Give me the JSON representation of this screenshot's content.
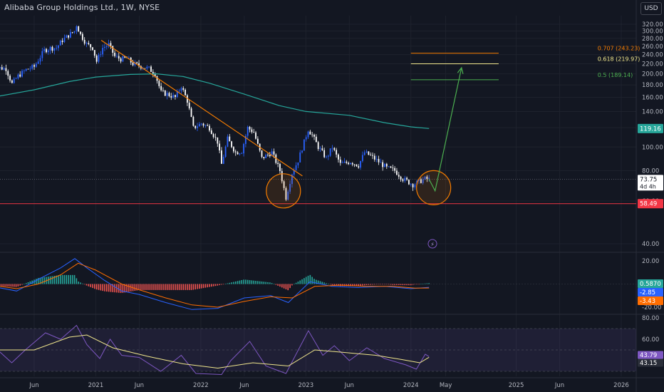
{
  "header": {
    "title": "Alibaba Group Holdings Ltd., 1W, NYSE",
    "currency_button": "USD"
  },
  "colors": {
    "background": "#131722",
    "grid": "#1e222d",
    "axis_text": "#b2b5be",
    "candle_up": "#2962ff",
    "candle_down": "#ffffff",
    "ma_line": "#26a69a",
    "trendline": "#f57c00",
    "fib_0707": "#f57c00",
    "fib_0618": "#f0e68c",
    "fib_05": "#4caf50",
    "support_line": "#f23645",
    "projection_arrow": "#4caf50",
    "circle_fill": "rgba(245,124,0,0.12)",
    "circle_stroke": "#f57c00",
    "macd_line": "#2962ff",
    "signal_line": "#ff6d00",
    "hist_pos": "#26a69a",
    "hist_neg": "#ef5350",
    "rsi_line": "#7e57c2",
    "rsi_ma": "#f0e68c",
    "rsi_band": "rgba(126,87,194,0.12)"
  },
  "chart_data": [
    {
      "type": "line",
      "panel": "price",
      "y_scale": "log",
      "ylim": [
        40,
        330
      ],
      "y_ticks": [
        "320.00",
        "300.00",
        "280.00",
        "260.00",
        "240.00",
        "220.00",
        "200.00",
        "180.00",
        "160.00",
        "140.00",
        "120.00",
        "100.00",
        "80.00",
        "60.00",
        "40.00"
      ],
      "x_ticks": [
        "Jun",
        "2021",
        "Jun",
        "2022",
        "Jun",
        "2023",
        "Jun",
        "2024",
        "May",
        "2025",
        "Jun",
        "2026"
      ],
      "x_tick_dates": [
        "2020-06-01",
        "2021-01-01",
        "2021-06-01",
        "2022-01-01",
        "2022-06-01",
        "2023-01-01",
        "2023-06-01",
        "2024-01-01",
        "2024-05-01",
        "2025-01-01",
        "2025-06-01",
        "2026-01-01"
      ],
      "x_range": [
        "2020-01-01",
        "2026-02-15"
      ],
      "series": [
        {
          "role": "price",
          "points": [
            [
              "2020-01-06",
              225
            ],
            [
              "2020-01-27",
              212
            ],
            [
              "2020-02-24",
              210
            ],
            [
              "2020-03-16",
              182
            ],
            [
              "2020-04-06",
              196
            ],
            [
              "2020-05-04",
              208
            ],
            [
              "2020-06-01",
              214
            ],
            [
              "2020-07-06",
              250
            ],
            [
              "2020-07-27",
              255
            ],
            [
              "2020-08-17",
              256
            ],
            [
              "2020-09-07",
              275
            ],
            [
              "2020-09-28",
              288
            ],
            [
              "2020-10-19",
              300
            ],
            [
              "2020-10-26",
              318
            ],
            [
              "2020-11-09",
              290
            ],
            [
              "2020-11-30",
              265
            ],
            [
              "2020-12-21",
              256
            ],
            [
              "2021-01-04",
              225
            ],
            [
              "2021-01-25",
              256
            ],
            [
              "2021-02-15",
              264
            ],
            [
              "2021-03-08",
              236
            ],
            [
              "2021-03-29",
              230
            ],
            [
              "2021-04-19",
              232
            ],
            [
              "2021-05-10",
              220
            ],
            [
              "2021-06-07",
              215
            ],
            [
              "2021-07-05",
              210
            ],
            [
              "2021-07-26",
              200
            ],
            [
              "2021-08-16",
              168
            ],
            [
              "2021-09-06",
              165
            ],
            [
              "2021-10-04",
              160
            ],
            [
              "2021-10-25",
              178
            ],
            [
              "2021-11-15",
              155
            ],
            [
              "2021-12-06",
              120
            ],
            [
              "2022-01-03",
              125
            ],
            [
              "2022-01-31",
              120
            ],
            [
              "2022-02-28",
              105
            ],
            [
              "2022-03-14",
              85
            ],
            [
              "2022-04-04",
              108
            ],
            [
              "2022-05-02",
              95
            ],
            [
              "2022-05-23",
              96
            ],
            [
              "2022-06-13",
              120
            ],
            [
              "2022-07-04",
              115
            ],
            [
              "2022-08-01",
              90
            ],
            [
              "2022-09-05",
              95
            ],
            [
              "2022-10-03",
              80
            ],
            [
              "2022-10-24",
              62
            ],
            [
              "2022-11-14",
              78
            ],
            [
              "2022-12-05",
              88
            ],
            [
              "2023-01-09",
              118
            ],
            [
              "2023-01-23",
              112
            ],
            [
              "2023-02-13",
              100
            ],
            [
              "2023-03-13",
              90
            ],
            [
              "2023-04-03",
              100
            ],
            [
              "2023-05-01",
              85
            ],
            [
              "2023-06-05",
              87
            ],
            [
              "2023-07-03",
              84
            ],
            [
              "2023-07-24",
              95
            ],
            [
              "2023-08-14",
              92
            ],
            [
              "2023-09-11",
              87
            ],
            [
              "2023-10-09",
              82
            ],
            [
              "2023-11-06",
              80
            ],
            [
              "2023-12-04",
              74
            ],
            [
              "2024-01-08",
              70
            ],
            [
              "2024-01-29",
              72
            ],
            [
              "2024-02-19",
              74
            ],
            [
              "2024-03-04",
              73.75
            ]
          ]
        },
        {
          "role": "moving-average",
          "points": [
            [
              "2020-01-06",
              160
            ],
            [
              "2020-06-01",
              172
            ],
            [
              "2020-10-01",
              186
            ],
            [
              "2021-01-01",
              194
            ],
            [
              "2021-05-01",
              199
            ],
            [
              "2021-08-01",
              200
            ],
            [
              "2021-11-01",
              195
            ],
            [
              "2022-02-01",
              183
            ],
            [
              "2022-06-01",
              165
            ],
            [
              "2022-10-01",
              148
            ],
            [
              "2023-01-01",
              140
            ],
            [
              "2023-06-01",
              135
            ],
            [
              "2023-10-01",
              126
            ],
            [
              "2024-01-01",
              121
            ],
            [
              "2024-03-04",
              119.16
            ]
          ]
        },
        {
          "role": "trendline",
          "points": [
            [
              "2021-01-20",
              275
            ],
            [
              "2022-12-20",
              76
            ]
          ]
        },
        {
          "role": "projection",
          "points": [
            [
              "2024-03-04",
              73.75
            ],
            [
              "2024-03-25",
              66
            ],
            [
              "2024-06-25",
              212
            ]
          ]
        }
      ],
      "levels": [
        {
          "label": "0.707 (243.23)",
          "value": 243.23,
          "start": "2024-01-01",
          "end": "2024-11-01",
          "color_key": "fib_0707"
        },
        {
          "label": "0.618 (219.97)",
          "value": 219.97,
          "start": "2024-01-01",
          "end": "2024-11-01",
          "color_key": "fib_0618"
        },
        {
          "label": "0.5 (189.14)",
          "value": 189.14,
          "start": "2024-01-01",
          "end": "2024-11-01",
          "color_key": "fib_05"
        }
      ],
      "support": {
        "value": 58.49,
        "label": "58.49"
      },
      "price_now": {
        "value": 73.75,
        "label": "73.75",
        "countdown": "4d 4h"
      },
      "ma_now": {
        "value": 119.16,
        "label": "119.16"
      },
      "highlights": [
        {
          "date": "2022-10-15",
          "value": 66
        },
        {
          "date": "2024-03-20",
          "value": 68
        }
      ]
    },
    {
      "type": "bar",
      "panel": "macd",
      "ylim": [
        -25,
        28
      ],
      "y_ticks": [
        "20.00",
        "-20.00"
      ],
      "last_values": [
        {
          "label": "0.5870",
          "value": 0.587,
          "color_key": "hist_pos"
        },
        {
          "label": "-2.85",
          "value": -2.85,
          "color_key": "macd_line"
        },
        {
          "label": "-3.43",
          "value": -3.43,
          "color_key": "signal_line"
        }
      ],
      "series": [
        {
          "name": "",
          "role": "macd",
          "points": [
            [
              "2020-01-06",
              -2
            ],
            [
              "2020-04-01",
              -6
            ],
            [
              "2020-06-15",
              4
            ],
            [
              "2020-09-01",
              14
            ],
            [
              "2020-10-20",
              22
            ],
            [
              "2020-12-01",
              14
            ],
            [
              "2021-02-01",
              3
            ],
            [
              "2021-04-01",
              -6
            ],
            [
              "2021-06-01",
              -9
            ],
            [
              "2021-09-01",
              -16
            ],
            [
              "2021-12-01",
              -22
            ],
            [
              "2022-03-01",
              -21
            ],
            [
              "2022-06-01",
              -12
            ],
            [
              "2022-09-01",
              -10
            ],
            [
              "2022-11-01",
              -16
            ],
            [
              "2023-01-15",
              2
            ],
            [
              "2023-04-01",
              -2
            ],
            [
              "2023-07-01",
              -3
            ],
            [
              "2023-10-01",
              -2
            ],
            [
              "2024-01-01",
              -4
            ],
            [
              "2024-03-04",
              -2.85
            ]
          ]
        },
        {
          "name": "",
          "role": "signal",
          "points": [
            [
              "2020-01-06",
              -1
            ],
            [
              "2020-04-01",
              -4
            ],
            [
              "2020-06-15",
              0
            ],
            [
              "2020-09-01",
              8
            ],
            [
              "2020-11-01",
              18
            ],
            [
              "2021-01-01",
              12
            ],
            [
              "2021-04-01",
              0
            ],
            [
              "2021-06-01",
              -5
            ],
            [
              "2021-09-01",
              -12
            ],
            [
              "2021-12-01",
              -18
            ],
            [
              "2022-03-01",
              -20
            ],
            [
              "2022-06-01",
              -15
            ],
            [
              "2022-09-01",
              -11
            ],
            [
              "2022-11-15",
              -12
            ],
            [
              "2023-02-01",
              -2
            ],
            [
              "2023-05-01",
              -1
            ],
            [
              "2023-08-01",
              -2
            ],
            [
              "2023-11-01",
              -2
            ],
            [
              "2024-01-15",
              -3.5
            ],
            [
              "2024-03-04",
              -3.43
            ]
          ]
        }
      ]
    },
    {
      "type": "line",
      "panel": "rsi",
      "ylim": [
        20,
        82
      ],
      "y_ticks": [
        "80.00",
        "60.00"
      ],
      "bands": [
        30,
        50,
        70
      ],
      "last_values": [
        {
          "label": "43.79",
          "value": 43.79,
          "color_key": "rsi_line"
        },
        {
          "label": "43.15",
          "value": 43.15,
          "color_key": "rsi_ma"
        }
      ],
      "series": [
        {
          "name": "",
          "role": "rsi",
          "points": [
            [
              "2020-01-06",
              55
            ],
            [
              "2020-03-15",
              38
            ],
            [
              "2020-05-01",
              50
            ],
            [
              "2020-07-10",
              66
            ],
            [
              "2020-09-01",
              60
            ],
            [
              "2020-10-26",
              73
            ],
            [
              "2020-12-01",
              55
            ],
            [
              "2021-01-15",
              42
            ],
            [
              "2021-02-20",
              60
            ],
            [
              "2021-04-01",
              45
            ],
            [
              "2021-06-01",
              43
            ],
            [
              "2021-08-15",
              30
            ],
            [
              "2021-10-25",
              45
            ],
            [
              "2021-12-15",
              28
            ],
            [
              "2022-03-14",
              27
            ],
            [
              "2022-04-15",
              40
            ],
            [
              "2022-06-20",
              58
            ],
            [
              "2022-08-15",
              35
            ],
            [
              "2022-10-24",
              28
            ],
            [
              "2023-01-10",
              68
            ],
            [
              "2023-03-01",
              45
            ],
            [
              "2023-04-10",
              54
            ],
            [
              "2023-06-01",
              40
            ],
            [
              "2023-08-01",
              52
            ],
            [
              "2023-10-01",
              42
            ],
            [
              "2023-12-15",
              36
            ],
            [
              "2024-01-20",
              32
            ],
            [
              "2024-02-20",
              46
            ],
            [
              "2024-03-04",
              43.79
            ]
          ]
        },
        {
          "name": "",
          "role": "rsi-ma",
          "points": [
            [
              "2020-01-06",
              50
            ],
            [
              "2020-06-01",
              50
            ],
            [
              "2020-10-01",
              62
            ],
            [
              "2020-12-01",
              64
            ],
            [
              "2021-03-01",
              52
            ],
            [
              "2021-07-01",
              44
            ],
            [
              "2021-11-01",
              37
            ],
            [
              "2022-03-01",
              33
            ],
            [
              "2022-07-01",
              38
            ],
            [
              "2022-11-01",
              35
            ],
            [
              "2023-02-01",
              50
            ],
            [
              "2023-05-01",
              48
            ],
            [
              "2023-09-01",
              45
            ],
            [
              "2023-12-01",
              41
            ],
            [
              "2024-02-01",
              38
            ],
            [
              "2024-03-04",
              43.15
            ]
          ]
        }
      ]
    }
  ]
}
